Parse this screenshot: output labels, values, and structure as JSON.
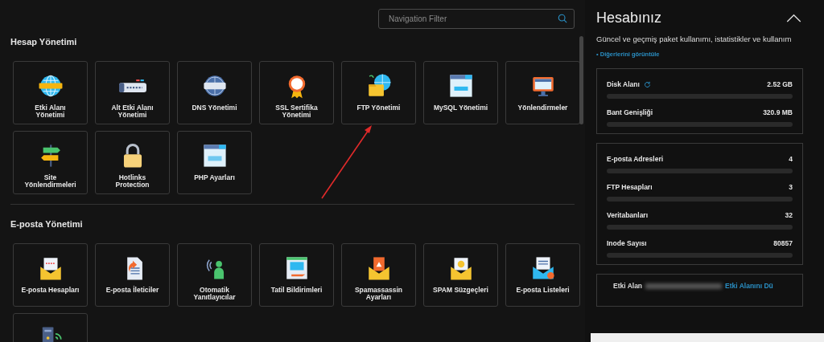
{
  "search": {
    "placeholder": "Navigation Filter"
  },
  "sections": [
    {
      "title": "Hesap Yönetimi",
      "tiles": [
        {
          "label": "Etki Alanı Yönetimi"
        },
        {
          "label": "Alt Etki Alanı Yönetimi"
        },
        {
          "label": "DNS Yönetimi"
        },
        {
          "label": "SSL Sertifika Yönetimi"
        },
        {
          "label": "FTP Yönetimi"
        },
        {
          "label": "MySQL Yönetimi"
        },
        {
          "label": "Yönlendirmeler"
        },
        {
          "label": "Site Yönlendirmeleri"
        },
        {
          "label": "Hotlinks Protection"
        },
        {
          "label": "PHP Ayarları"
        }
      ]
    },
    {
      "title": "E-posta Yönetimi",
      "tiles": [
        {
          "label": "E-posta Hesapları"
        },
        {
          "label": "E-posta İleticiler"
        },
        {
          "label": "Otomatik Yanıtlayıcılar"
        },
        {
          "label": "Tatil Bildirimleri"
        },
        {
          "label": "Spamassassin Ayarları"
        },
        {
          "label": "SPAM Süzgeçleri"
        },
        {
          "label": "E-posta Listeleri"
        }
      ]
    }
  ],
  "account": {
    "title": "Hesabınız",
    "description": "Güncel ve geçmiş paket kullanımı, istatistikler ve kullanım",
    "more_link": "• Diğerlerini görüntüle",
    "usage_cards": [
      {
        "items": [
          {
            "name": "Disk Alanı",
            "refresh": true,
            "value": "2.52 GB"
          },
          {
            "name": "Bant Genişliği",
            "refresh": false,
            "value": "320.9 MB"
          }
        ]
      },
      {
        "items": [
          {
            "name": "E-posta Adresleri",
            "refresh": false,
            "value": "4"
          },
          {
            "name": "FTP Hesapları",
            "refresh": false,
            "value": "3"
          },
          {
            "name": "Veritabanları",
            "refresh": false,
            "value": "32"
          },
          {
            "name": "Inode Sayısı",
            "refresh": false,
            "value": "80857"
          }
        ]
      }
    ],
    "domain_card": {
      "label": "Etki Alan",
      "link": "Etki Alanını Dü"
    }
  }
}
